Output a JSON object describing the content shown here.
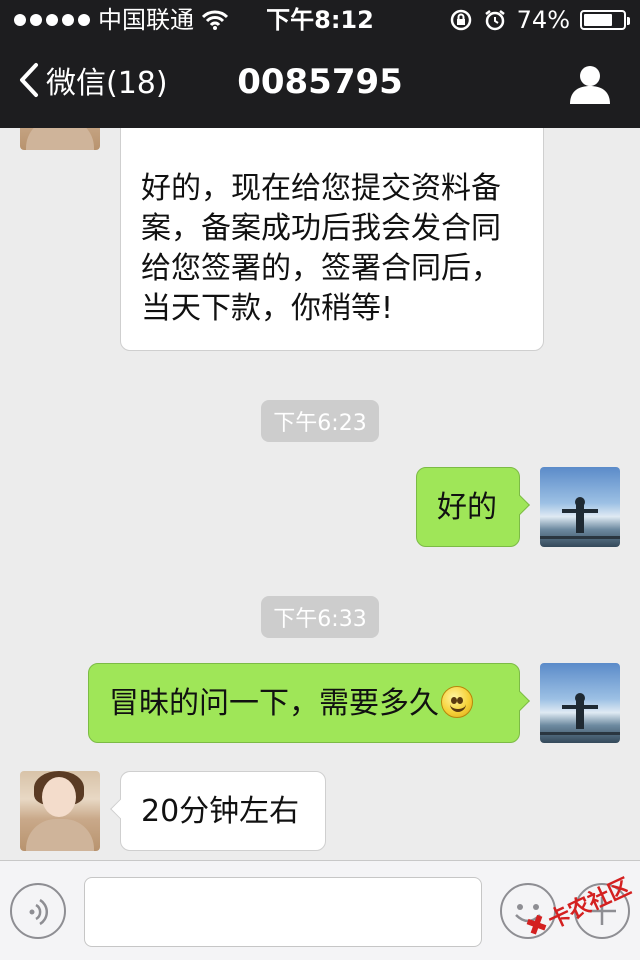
{
  "status_bar": {
    "carrier": "中国联通",
    "time": "下午8:12",
    "battery": "74%",
    "battery_level": 0.74
  },
  "nav": {
    "back_label": "微信(18)",
    "title": "0085795"
  },
  "messages": [
    {
      "side": "left",
      "text_lines": [
        "好的，现在给您提交资料备",
        "案，备案成功后我会发合同",
        "给您签署的，签署合同后，",
        "当天下款，你稍等!"
      ]
    },
    {
      "timestamp": "下午6:23"
    },
    {
      "side": "right",
      "text": "好的"
    },
    {
      "timestamp": "下午6:33"
    },
    {
      "side": "right",
      "text": "冒昧的问一下，需要多久",
      "emoji": "smile-emoji"
    },
    {
      "side": "left",
      "text": "20分钟左右"
    }
  ],
  "input_bar": {
    "voice_icon": "voice-icon",
    "emoji_icon": "emoji-icon",
    "plus_icon": "plus-icon",
    "value": ""
  },
  "watermark": "卡农社区",
  "colors": {
    "nav_bg": "#1d1d1f",
    "chat_bg": "#ececec",
    "bubble_green": "#9fe658",
    "bubble_white": "#ffffff",
    "timestamp_bg": "#cdcdcd",
    "watermark": "#d42020"
  }
}
